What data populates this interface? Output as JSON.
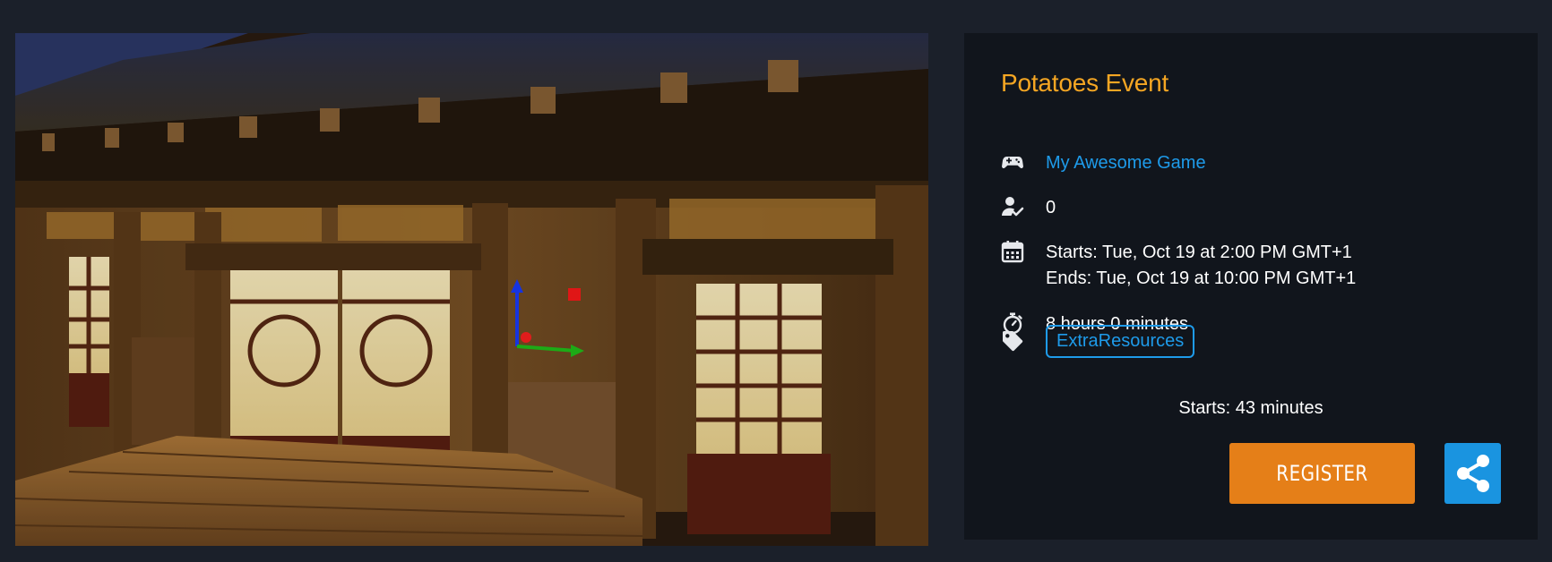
{
  "event": {
    "title": "Potatoes Event",
    "game": "My Awesome Game",
    "registered_count": "0",
    "starts": "Starts: Tue, Oct 19 at 2:00 PM GMT+1",
    "ends": "Ends: Tue, Oct 19 at 10:00 PM GMT+1",
    "duration": "8 hours 0 minutes",
    "tag": "ExtraResources",
    "countdown": "Starts: 43 minutes"
  },
  "actions": {
    "register_label": "REGISTER"
  },
  "icons": {
    "game": "gamepad-icon",
    "users": "user-check-icon",
    "dates": "calendar-icon",
    "duration": "stopwatch-icon",
    "tag": "tag-icon",
    "share": "share-icon"
  },
  "colors": {
    "page_bg": "#1b202a",
    "card_bg": "#11151c",
    "title": "#f5a623",
    "link": "#1e9bea",
    "register_bg": "#e57f18",
    "share_bg": "#1a94e0"
  }
}
